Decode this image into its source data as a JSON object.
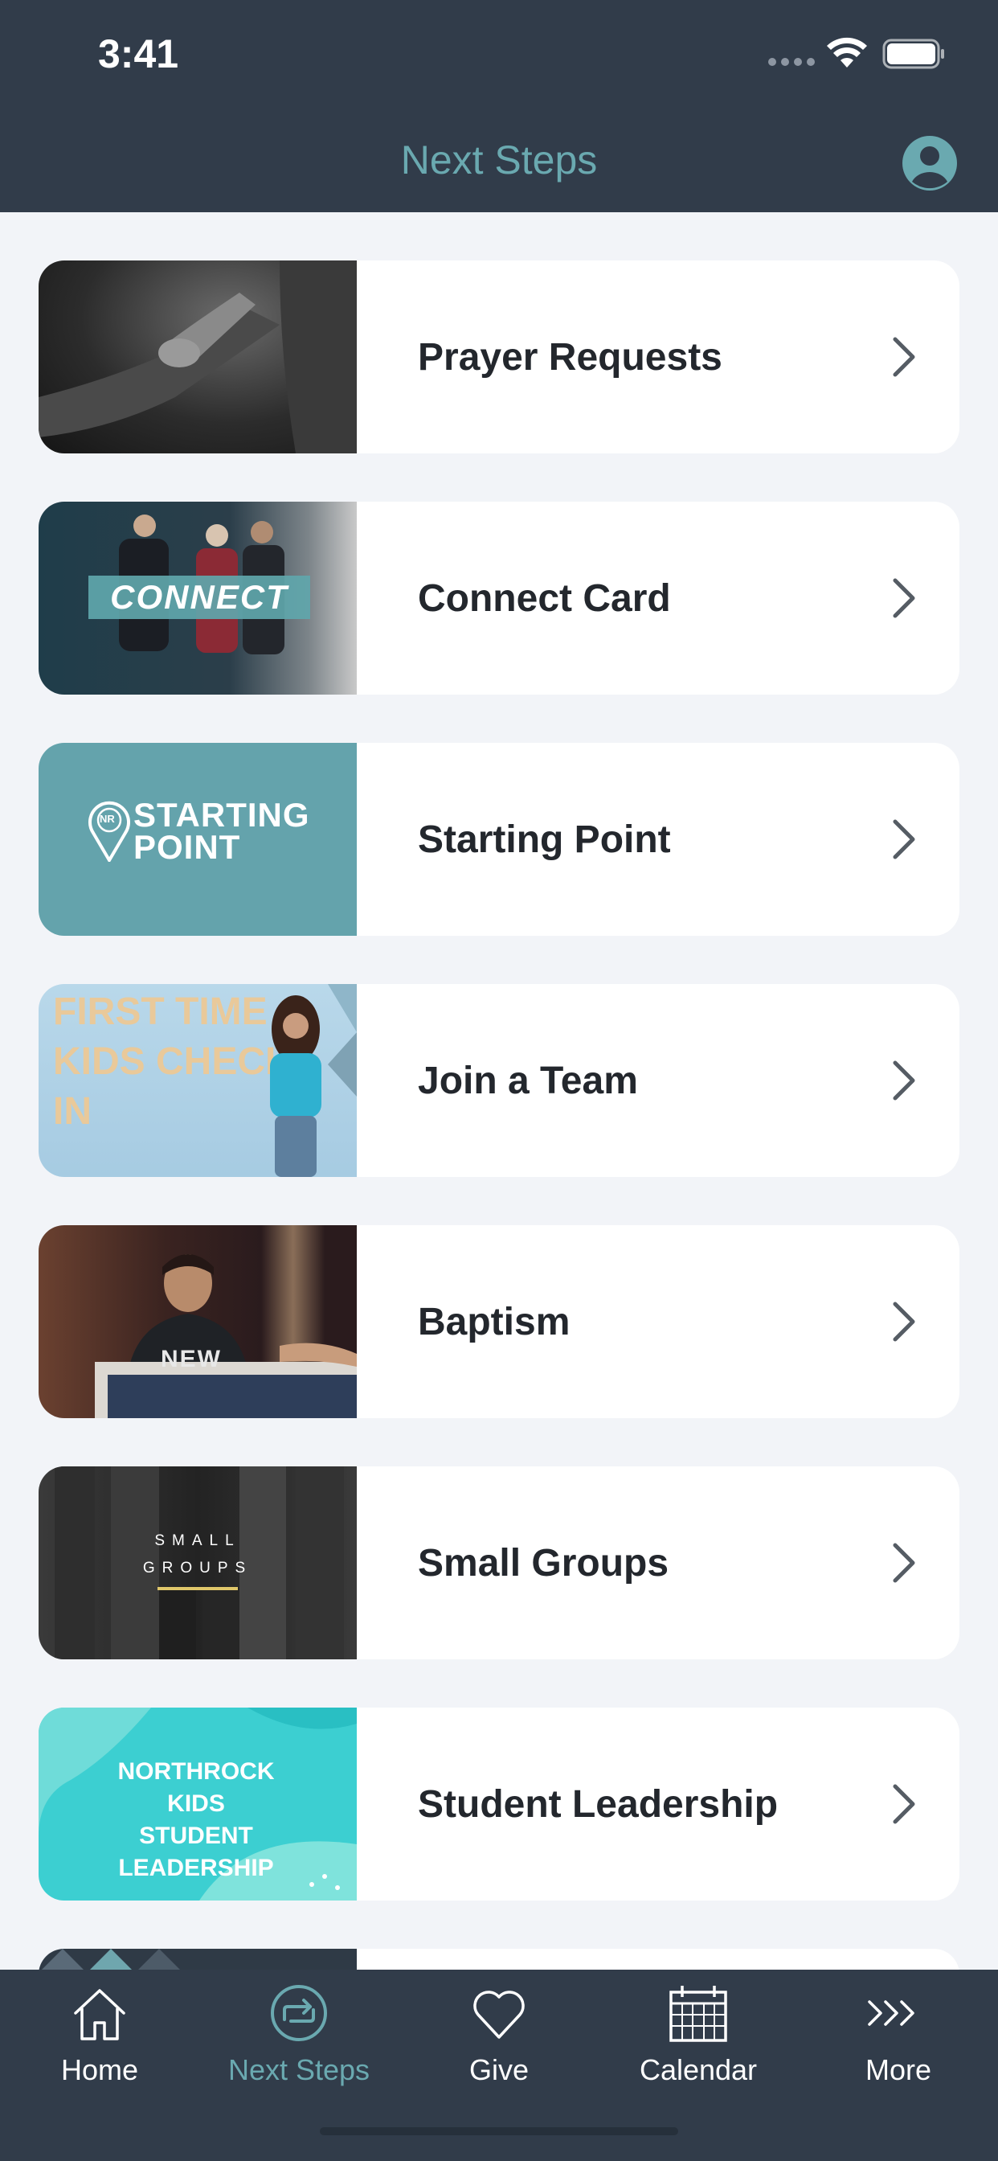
{
  "status_bar": {
    "time": "3:41"
  },
  "header": {
    "title": "Next Steps"
  },
  "items": [
    {
      "label": "Prayer Requests",
      "thumb_text": ""
    },
    {
      "label": "Connect Card",
      "thumb_text": "CONNECT"
    },
    {
      "label": "Starting Point",
      "thumb_text": "STARTING POINT",
      "thumb_logo": "NR"
    },
    {
      "label": "Join a Team",
      "thumb_text": "FIRST TIME KIDS CHECK-IN"
    },
    {
      "label": "Baptism",
      "thumb_text": "NEW"
    },
    {
      "label": "Small Groups",
      "thumb_text": "SMALL GROUPS"
    },
    {
      "label": "Student Leadership",
      "thumb_text": "NORTHROCK KIDS STUDENT LEADERSHIP"
    }
  ],
  "tabs": [
    {
      "label": "Home",
      "icon": "home-icon"
    },
    {
      "label": "Next Steps",
      "icon": "next-steps-icon",
      "active": true
    },
    {
      "label": "Give",
      "icon": "heart-icon"
    },
    {
      "label": "Calendar",
      "icon": "calendar-icon"
    },
    {
      "label": "More",
      "icon": "more-icon"
    }
  ],
  "colors": {
    "bar_background": "#313c4a",
    "accent": "#6aa9b0",
    "page_background": "#f2f4f8"
  }
}
